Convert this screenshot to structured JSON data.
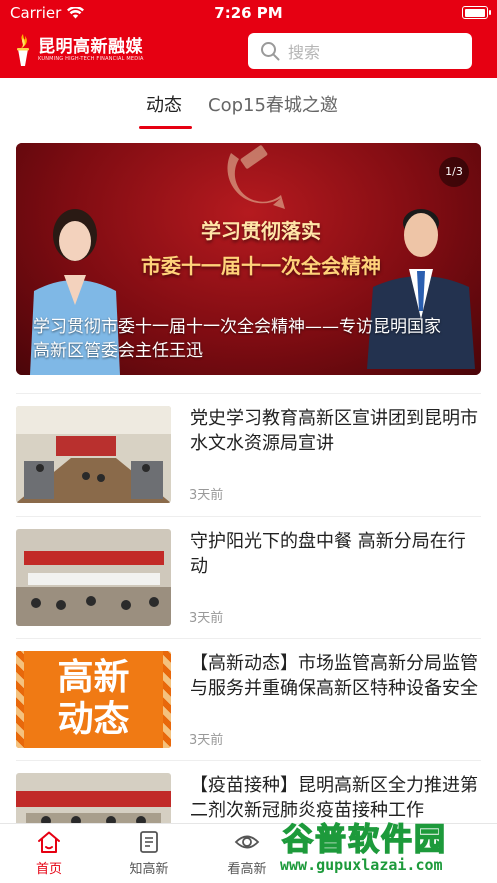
{
  "status_bar": {
    "carrier": "Carrier",
    "time": "7:26 PM"
  },
  "app_bar": {
    "logo_title": "昆明高新融媒",
    "logo_subtitle": "KUNMING HIGH-TECH FINANCIAL MEDIA",
    "search_placeholder": "搜索"
  },
  "tabs": [
    {
      "label": "动态",
      "active": true
    },
    {
      "label": "Cop15春城之邀",
      "active": false
    }
  ],
  "banner": {
    "counter": "1/3",
    "slogan_line1": "学习贯彻落实",
    "slogan_line2": "市委十一届十一次全会精神",
    "caption": "学习贯彻市委十一届十一次全会精神——专访昆明国家高新区管委会主任王迅"
  },
  "news": [
    {
      "title": "党史学习教育高新区宣讲团到昆明市水文水资源局宣讲",
      "time": "3天前"
    },
    {
      "title": "守护阳光下的盘中餐 高新分局在行动",
      "time": "3天前"
    },
    {
      "title": "【高新动态】市场监管高新分局监管与服务并重确保高新区特种设备安全",
      "time": "3天前",
      "thumb_text_1": "高新",
      "thumb_text_2": "动态"
    },
    {
      "title": "【疫苗接种】昆明高新区全力推进第二剂次新冠肺炎疫苗接种工作",
      "time": ""
    }
  ],
  "tabbar": [
    {
      "label": "首页",
      "icon": "home-icon",
      "active": true
    },
    {
      "label": "知高新",
      "icon": "document-icon",
      "active": false
    },
    {
      "label": "看高新",
      "icon": "eye-icon",
      "active": false
    }
  ],
  "watermark": {
    "title": "谷普软件园",
    "url": "www.gupuxlazai.com"
  },
  "colors": {
    "brand": "#e60012",
    "text": "#222222",
    "muted": "#999999",
    "watermark": "#1d9a3b"
  }
}
